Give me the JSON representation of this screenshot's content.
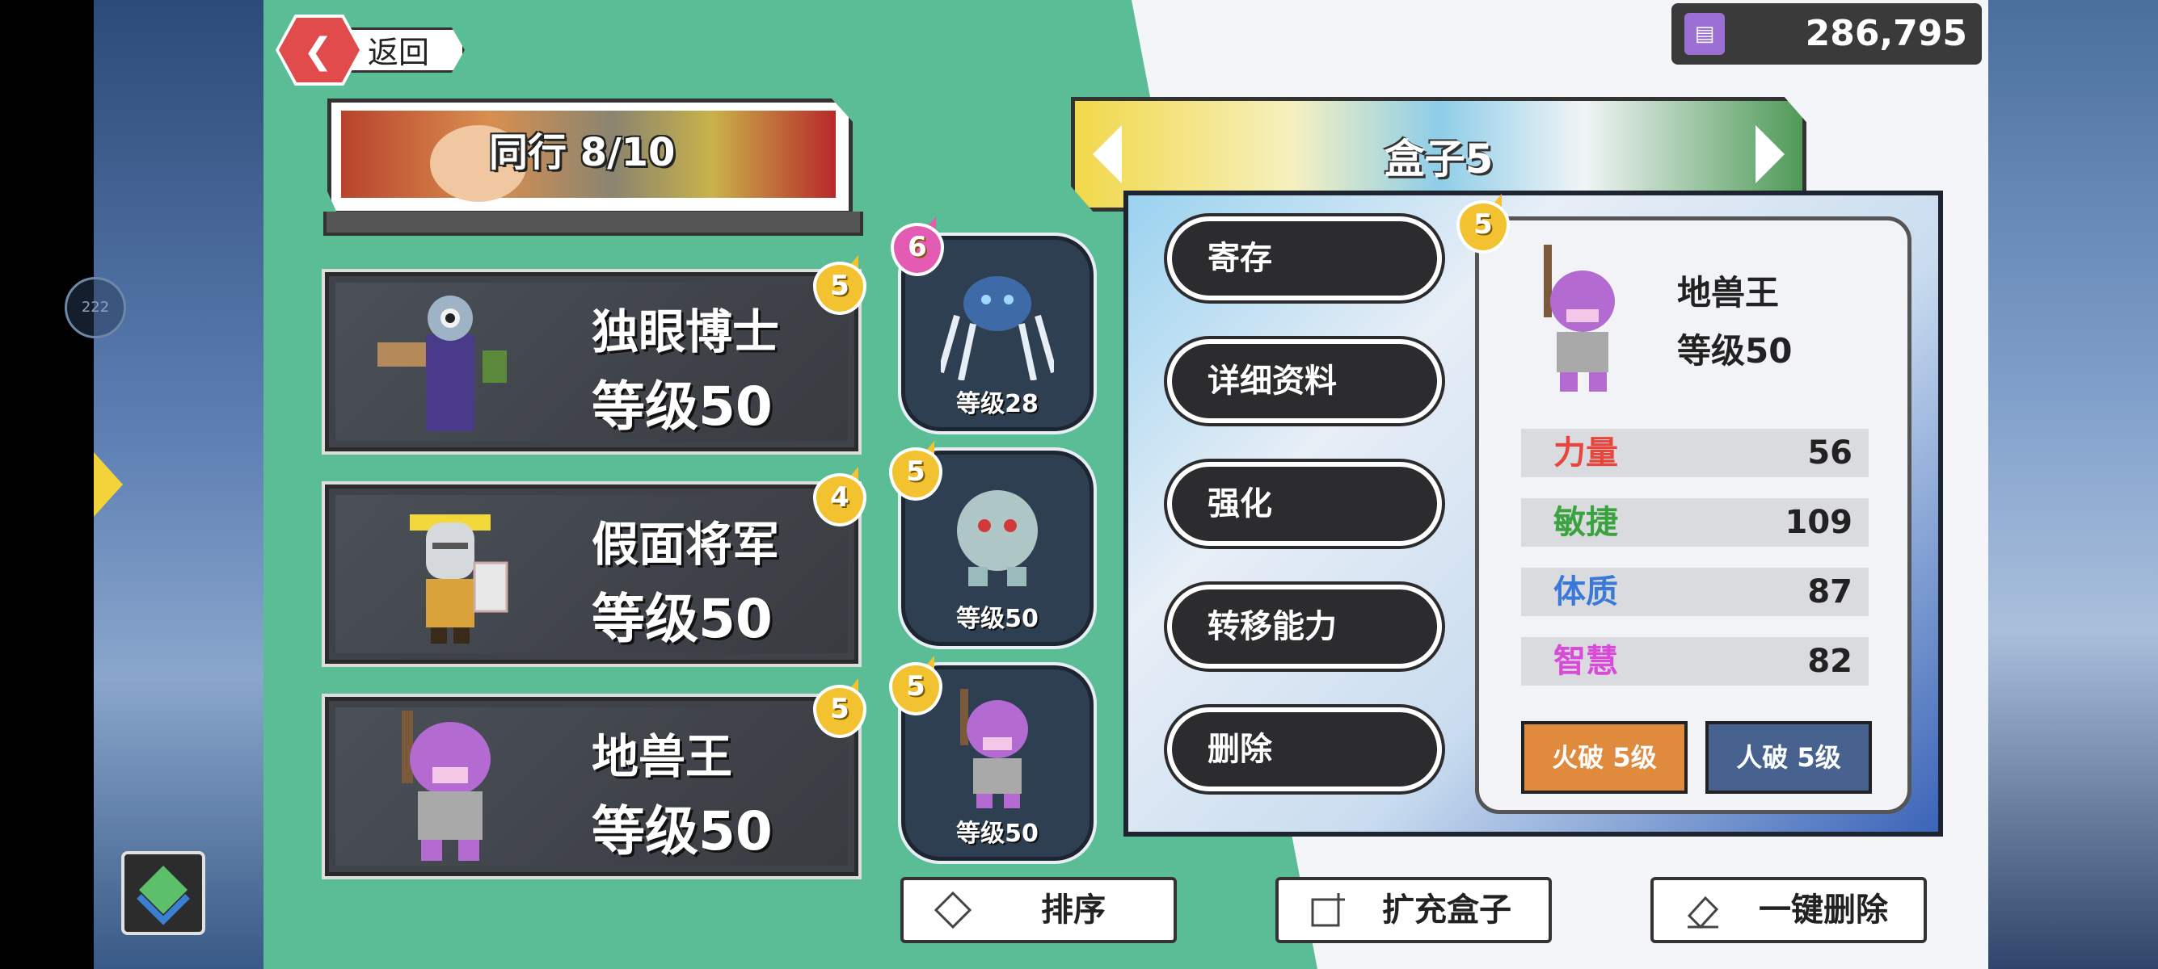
{
  "header": {
    "back_label": "返回",
    "currency_value": "286,795",
    "currency_icon": "coin-icon"
  },
  "side": {
    "circle_label": "222"
  },
  "party": {
    "title": "同行 8/10",
    "cards": [
      {
        "name": "独眼博士",
        "level": "等级50",
        "stars": "5"
      },
      {
        "name": "假面将军",
        "level": "等级50",
        "stars": "4"
      },
      {
        "name": "地兽王",
        "level": "等级50",
        "stars": "5"
      }
    ]
  },
  "box": {
    "title": "盒子5",
    "slots": [
      {
        "level": "等级28",
        "stars": "6"
      },
      {
        "level": "等级50",
        "stars": "5"
      },
      {
        "level": "等级50",
        "stars": "5"
      }
    ]
  },
  "popup": {
    "menu": [
      "寄存",
      "详细资料",
      "强化",
      "转移能力",
      "删除"
    ],
    "stars": "5",
    "monster_name": "地兽王",
    "monster_level": "等级50",
    "stats": [
      {
        "label": "力量",
        "value": "56",
        "color": "#e8453c"
      },
      {
        "label": "敏捷",
        "value": "109",
        "color": "#3aa23f"
      },
      {
        "label": "体质",
        "value": "87",
        "color": "#3b78d8"
      },
      {
        "label": "智慧",
        "value": "82",
        "color": "#d94ad9"
      }
    ],
    "break_fire": "火破 5级",
    "break_human": "人破 5级"
  },
  "bottom": {
    "sort_label": "排序",
    "expand_label": "扩充盒子",
    "delete_all_label": "一键删除"
  }
}
